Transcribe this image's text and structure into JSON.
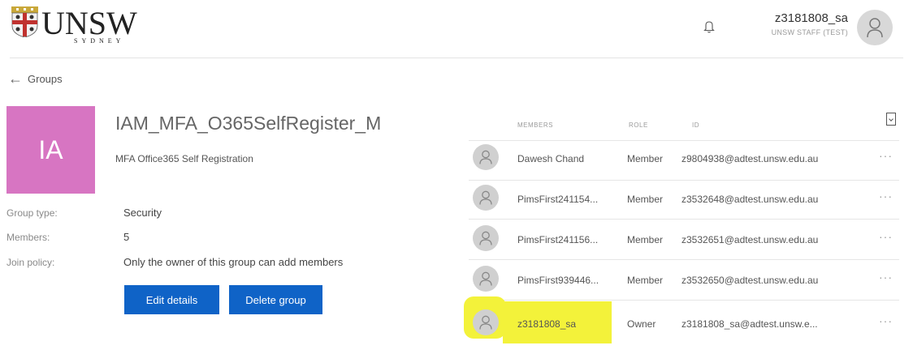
{
  "header": {
    "logo_name": "UNSW",
    "logo_sub": "SYDNEY",
    "bell_icon": "bell-icon",
    "user_id": "z3181808_sa",
    "user_role": "UNSW STAFF (TEST)",
    "avatar_icon": "person-icon"
  },
  "nav": {
    "back_label": "Groups",
    "back_icon": "arrow-left-icon"
  },
  "group": {
    "initials": "IA",
    "tile_color": "#d775c2",
    "name": "IAM_MFA_O365SelfRegister_M",
    "description": "MFA Office365 Self Registration",
    "properties": [
      {
        "label": "Group type:",
        "value": "Security"
      },
      {
        "label": "Members:",
        "value": "5"
      },
      {
        "label": "Join policy:",
        "value": "Only the owner of this group can add members"
      }
    ],
    "edit_label": "Edit details",
    "delete_label": "Delete group",
    "button_color": "#0f63c7"
  },
  "members_table": {
    "columns": [
      "MEMBERS",
      "ROLE",
      "ID"
    ],
    "export_icon": "export-icon",
    "more_label": "···",
    "rows": [
      {
        "name": "Dawesh Chand",
        "role": "Member",
        "id": "z9804938@adtest.unsw.edu.au"
      },
      {
        "name": "PimsFirst241154...",
        "role": "Member",
        "id": "z3532648@adtest.unsw.edu.au"
      },
      {
        "name": "PimsFirst241156...",
        "role": "Member",
        "id": "z3532651@adtest.unsw.edu.au"
      },
      {
        "name": "PimsFirst939446...",
        "role": "Member",
        "id": "z3532650@adtest.unsw.edu.au"
      },
      {
        "name": "z3181808_sa",
        "role": "Owner",
        "id": "z3181808_sa@adtest.unsw.e...",
        "highlighted": true
      }
    ],
    "highlight_color": "#f3f23a"
  }
}
